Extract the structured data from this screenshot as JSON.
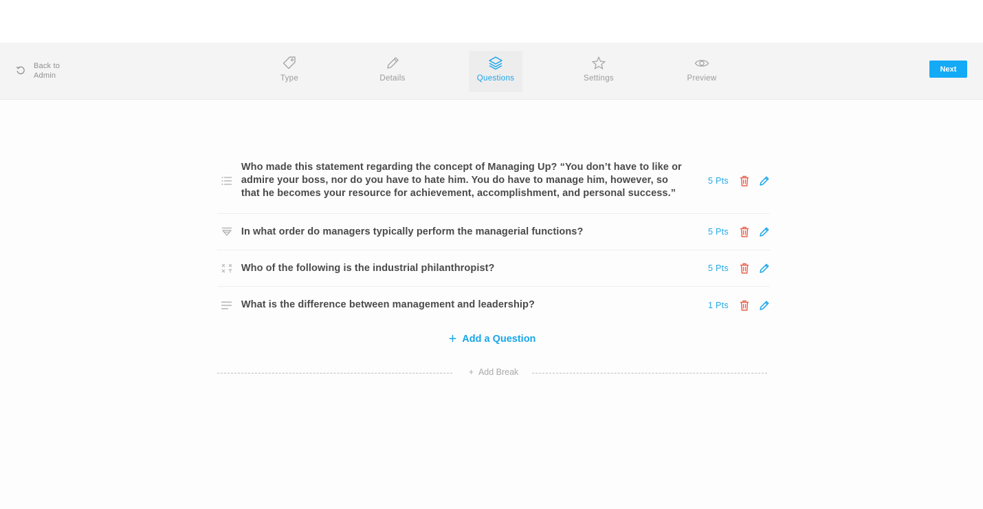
{
  "nav": {
    "back_label": "Back to Admin",
    "next_label": "Next",
    "steps": [
      {
        "label": "Type",
        "icon": "tag-icon"
      },
      {
        "label": "Details",
        "icon": "pencil-icon"
      },
      {
        "label": "Questions",
        "icon": "layers-icon",
        "active": true
      },
      {
        "label": "Settings",
        "icon": "star-icon"
      },
      {
        "label": "Preview",
        "icon": "eye-icon"
      }
    ]
  },
  "questions": [
    {
      "type_icon": "list-icon",
      "text": "Who made this statement regarding the concept of Managing Up? “You don’t have to like or admire your boss, nor do you have to hate him. You do have to manage him, however, so that he becomes your resource for achievement, accomplishment, and personal success.”",
      "points": "5 Pts"
    },
    {
      "type_icon": "ordering-icon",
      "text": "In what order do managers typically perform the managerial functions?",
      "points": "5 Pts"
    },
    {
      "type_icon": "matching-icon",
      "text": "Who of the following is the industrial philanthropist?",
      "points": "5 Pts"
    },
    {
      "type_icon": "text-lines-icon",
      "text": "What is the difference between management and leadership?",
      "points": "1 Pts"
    }
  ],
  "add_question_label": "Add a Question",
  "add_break_label": "Add Break",
  "colors": {
    "accent": "#14aaf5",
    "delete": "#e8604c",
    "text": "#4a4a4a",
    "muted": "#9a9a9a"
  }
}
